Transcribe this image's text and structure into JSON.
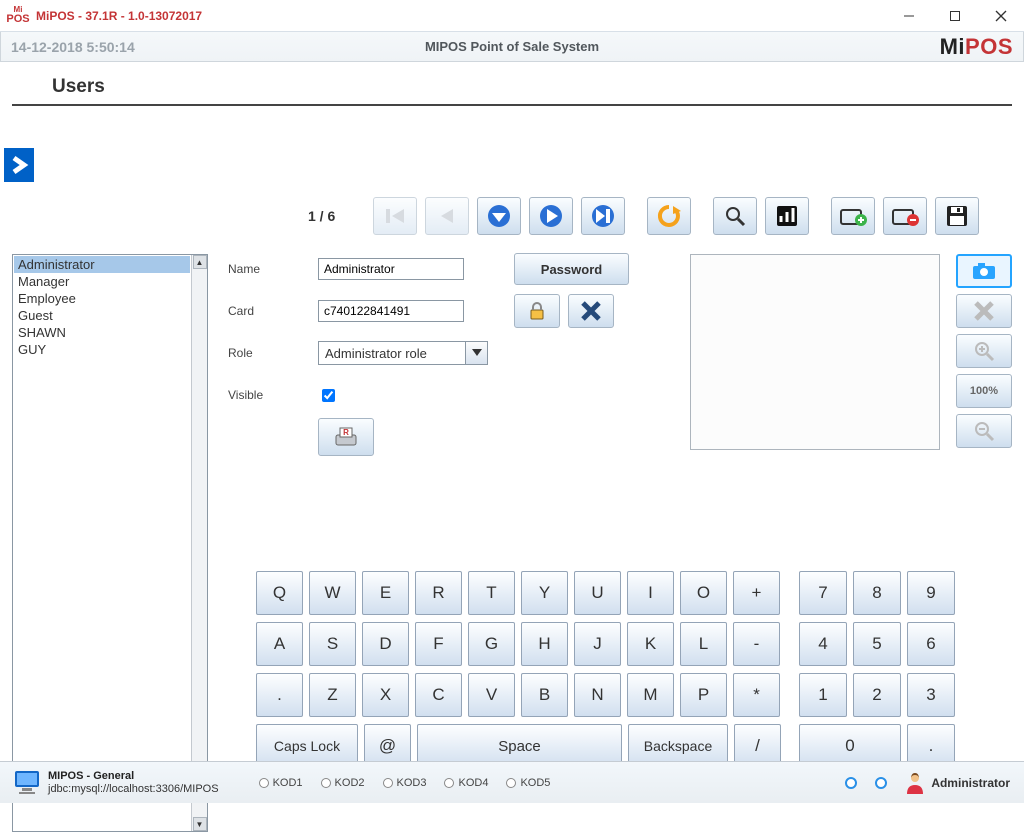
{
  "window": {
    "title": "MiPOS - 37.1R - 1.0-13072017",
    "date": "14-12-2018 5:50:14",
    "systemName": "MIPOS Point of Sale System",
    "brandLeft": "Mi",
    "brandRight": "POS"
  },
  "section": {
    "title": "Users"
  },
  "pager": {
    "text": "1 / 6"
  },
  "userList": {
    "items": [
      "Administrator",
      "Manager",
      "Employee",
      "Guest",
      "SHAWN",
      "GUY"
    ],
    "selectedIndex": 0
  },
  "form": {
    "labels": {
      "name": "Name",
      "card": "Card",
      "role": "Role",
      "visible": "Visible"
    },
    "name": "Administrator",
    "card": "c740122841491",
    "role": "Administrator role",
    "visibleChecked": true,
    "passwordButton": "Password"
  },
  "sideTools": {
    "percent": "100%"
  },
  "keyboard": {
    "row1": [
      "Q",
      "W",
      "E",
      "R",
      "T",
      "Y",
      "U",
      "I",
      "O",
      "+"
    ],
    "row2": [
      "A",
      "S",
      "D",
      "F",
      "G",
      "H",
      "J",
      "K",
      "L",
      "-"
    ],
    "row3": [
      ".",
      "Z",
      "X",
      "C",
      "V",
      "B",
      "N",
      "M",
      "P",
      "*"
    ],
    "row4": {
      "caps": "Caps Lock",
      "at": "@",
      "space": "Space",
      "back": "Backspace",
      "slash": "/"
    },
    "numCol": {
      "r1": [
        "7",
        "8",
        "9"
      ],
      "r2": [
        "4",
        "5",
        "6"
      ],
      "r3": [
        "1",
        "2",
        "3"
      ],
      "r4": [
        "0",
        "."
      ]
    }
  },
  "footer": {
    "title": "MIPOS - General",
    "conn": "jdbc:mysql://localhost:3306/MIPOS",
    "kods": [
      "KOD1",
      "KOD2",
      "KOD3",
      "KOD4",
      "KOD5"
    ],
    "user": "Administrator"
  }
}
